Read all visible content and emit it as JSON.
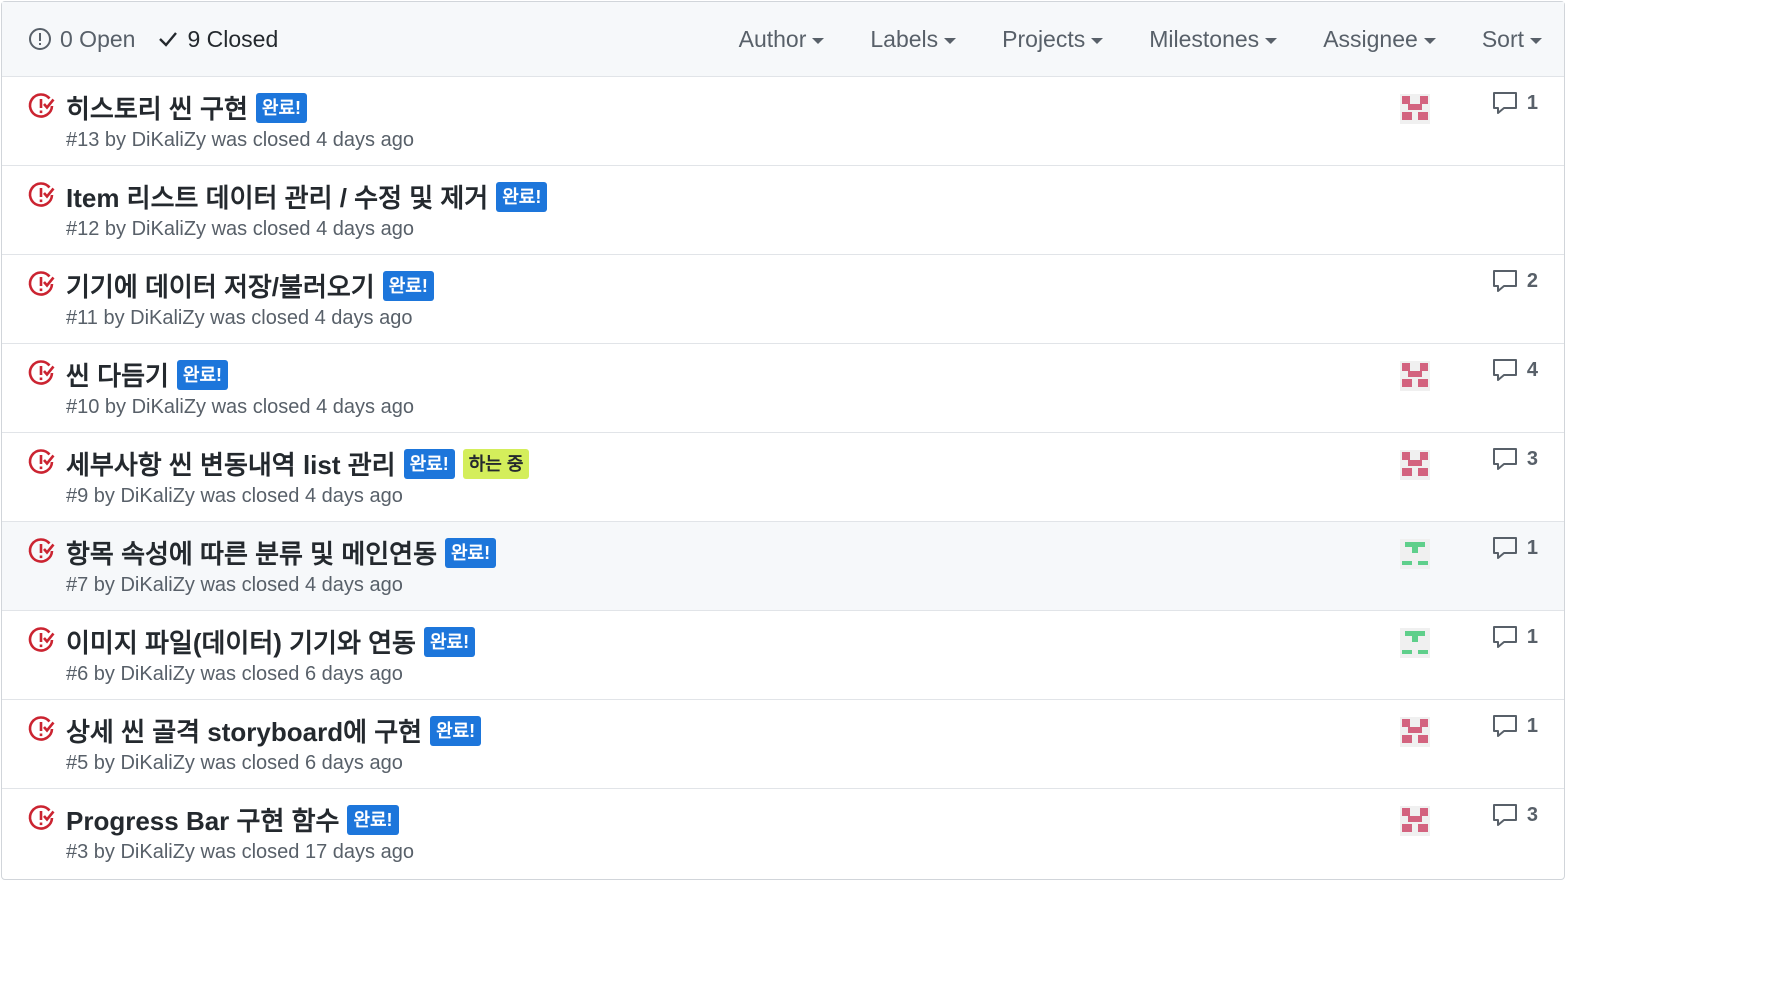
{
  "header": {
    "open_label": "0 Open",
    "closed_label": "9 Closed",
    "filters": [
      "Author",
      "Labels",
      "Projects",
      "Milestones",
      "Assignee",
      "Sort"
    ]
  },
  "colors": {
    "closed_icon": "#cb2431",
    "label_done": "#1d76db",
    "label_doing": "#d4ee5b",
    "avatar_pink": "#d3637f",
    "avatar_green": "#5fcf8b"
  },
  "issues": [
    {
      "title": "히스토리 씬 구현",
      "labels": [
        "완료!"
      ],
      "meta": "#13 by DiKaliZy was closed 4 days ago",
      "avatar": "pink",
      "comments": "1"
    },
    {
      "title": "Item 리스트 데이터 관리 / 수정 및 제거",
      "labels": [
        "완료!"
      ],
      "meta": "#12 by DiKaliZy was closed 4 days ago",
      "avatar": null,
      "comments": null
    },
    {
      "title": "기기에 데이터 저장/불러오기",
      "labels": [
        "완료!"
      ],
      "meta": "#11 by DiKaliZy was closed 4 days ago",
      "avatar": null,
      "comments": "2"
    },
    {
      "title": "씬 다듬기",
      "labels": [
        "완료!"
      ],
      "meta": "#10 by DiKaliZy was closed 4 days ago",
      "avatar": "pink",
      "comments": "4"
    },
    {
      "title": "세부사항 씬 변동내역 list 관리",
      "labels": [
        "완료!",
        "하는 중"
      ],
      "meta": "#9 by DiKaliZy was closed 4 days ago",
      "avatar": "pink",
      "comments": "3"
    },
    {
      "title": "항목 속성에 따른 분류 및 메인연동",
      "labels": [
        "완료!"
      ],
      "meta": "#7 by DiKaliZy was closed 4 days ago",
      "avatar": "green",
      "comments": "1"
    },
    {
      "title": "이미지 파일(데이터) 기기와 연동",
      "labels": [
        "완료!"
      ],
      "meta": "#6 by DiKaliZy was closed 6 days ago",
      "avatar": "green",
      "comments": "1"
    },
    {
      "title": "상세 씬 골격 storyboard에 구현",
      "labels": [
        "완료!"
      ],
      "meta": "#5 by DiKaliZy was closed 6 days ago",
      "avatar": "pink",
      "comments": "1"
    },
    {
      "title": "Progress Bar 구현 함수",
      "labels": [
        "완료!"
      ],
      "meta": "#3 by DiKaliZy was closed 17 days ago",
      "avatar": "pink",
      "comments": "3"
    }
  ]
}
